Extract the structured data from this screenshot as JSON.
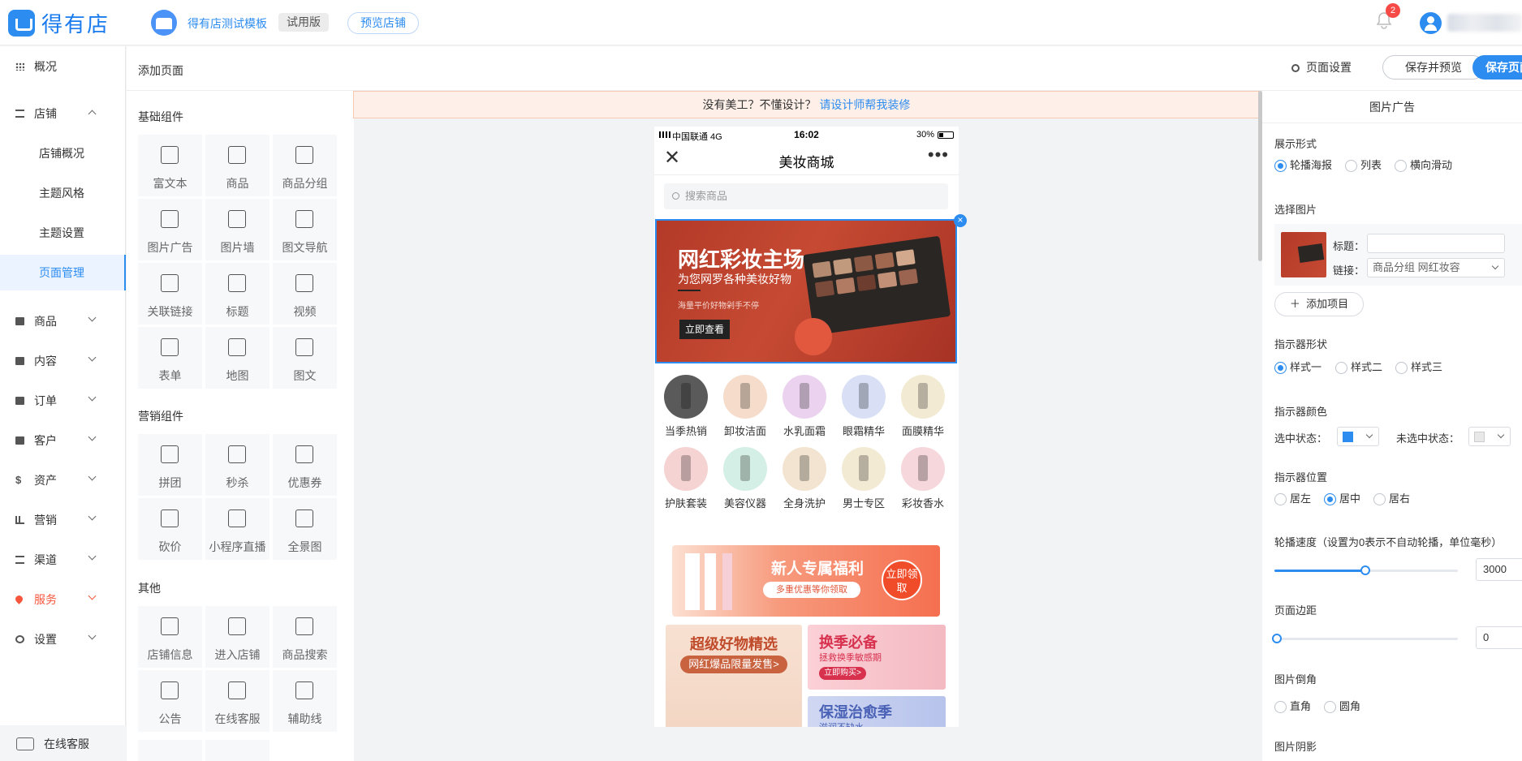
{
  "header": {
    "brand": "得有店",
    "store_name": "得有店测试模板",
    "plan": "试用版",
    "preview_store": "预览店铺",
    "notification_count": "2"
  },
  "nav": {
    "items": [
      {
        "label": "概况",
        "icon": "grid-icon"
      },
      {
        "label": "店铺",
        "icon": "store-icon",
        "expanded": true
      },
      {
        "label": "商品",
        "icon": "goods-icon"
      },
      {
        "label": "内容",
        "icon": "content-icon"
      },
      {
        "label": "订单",
        "icon": "order-icon"
      },
      {
        "label": "客户",
        "icon": "customer-icon"
      },
      {
        "label": "资产",
        "icon": "dollar-icon"
      },
      {
        "label": "营销",
        "icon": "chart-icon"
      },
      {
        "label": "渠道",
        "icon": "layers-icon"
      },
      {
        "label": "服务",
        "icon": "heart-icon",
        "color": "#f5563c"
      },
      {
        "label": "设置",
        "icon": "gear-icon"
      }
    ],
    "sub_items": [
      "店铺概况",
      "主题风格",
      "主题设置",
      "页面管理"
    ],
    "online_service": "在线客服"
  },
  "components": {
    "add_page": "添加页面",
    "basic_title": "基础组件",
    "basic": [
      "富文本",
      "商品",
      "商品分组",
      "图片广告",
      "图片墙",
      "图文导航",
      "关联链接",
      "标题",
      "视频",
      "表单",
      "地图",
      "图文"
    ],
    "marketing_title": "营销组件",
    "marketing": [
      "拼团",
      "秒杀",
      "优惠券",
      "砍价",
      "小程序直播",
      "全景图"
    ],
    "other_title": "其他",
    "other": [
      "店铺信息",
      "进入店铺",
      "商品搜索",
      "公告",
      "在线客服",
      "辅助线"
    ]
  },
  "toolbar": {
    "page_settings": "页面设置",
    "save_preview": "保存并预览",
    "save": "保存页面"
  },
  "tip": {
    "text": "没有美工？不懂设计？",
    "link": "请设计师帮我装修"
  },
  "phone": {
    "carrier": "中国联通  4G",
    "time": "16:02",
    "battery": "30%",
    "title": "美妆商城",
    "search_placeholder": "搜索商品",
    "banner": {
      "title": "网红彩妆主场",
      "subtitle": "为您网罗各种美妆好物",
      "note": "海量平价好物剁手不停",
      "button": "立即查看"
    },
    "categories": [
      {
        "label": "当季热销",
        "color": "#5a5a5a"
      },
      {
        "label": "卸妆洁面",
        "color": "#f5dccb"
      },
      {
        "label": "水乳面霜",
        "color": "#ebd3ef"
      },
      {
        "label": "眼霜精华",
        "color": "#d9dff5"
      },
      {
        "label": "面膜精华",
        "color": "#f3ead4"
      },
      {
        "label": "护肤套装",
        "color": "#f6d3d3"
      },
      {
        "label": "美容仪器",
        "color": "#d4efe5"
      },
      {
        "label": "全身洗护",
        "color": "#f2e4d0"
      },
      {
        "label": "男士专区",
        "color": "#f3ead4"
      },
      {
        "label": "彩妆香水",
        "color": "#f6d7dc"
      }
    ],
    "promo": {
      "title": "新人专属福利",
      "subtitle": "多重优惠等你领取",
      "badge": "立即领取"
    },
    "card_a": {
      "title": "超级好物精选",
      "tag": "网红爆品限量发售>"
    },
    "card_b": {
      "title": "换季必备",
      "subtitle": "拯救换季敏感期",
      "tag": "立即购买>"
    },
    "card_c": {
      "title": "保湿治愈季",
      "subtitle": "滋润不缺水"
    }
  },
  "panel": {
    "title": "图片广告",
    "display_label": "展示形式",
    "display_options": [
      "轮播海报",
      "列表",
      "横向滑动"
    ],
    "choose_image": "选择图片",
    "title_label": "标题：",
    "link_label": "链接：",
    "link_value": "商品分组  网红妆容",
    "add_item": "添加项目",
    "indicator_shape": "指示器形状",
    "shape_options": [
      "样式一",
      "样式二",
      "样式三"
    ],
    "indicator_color": "指示器颜色",
    "selected_state": "选中状态：",
    "unselected_state": "未选中状态：",
    "selected_color": "#2d8cf0",
    "unselected_color": "#e8e8e8",
    "indicator_position": "指示器位置",
    "position_options": [
      "居左",
      "居中",
      "居右"
    ],
    "speed_label": "轮播速度（设置为0表示不自动轮播，单位毫秒）",
    "speed_value": "3000",
    "margin_label": "页面边距",
    "margin_value": "0",
    "corner_label": "图片倒角",
    "corner_options": [
      "直角",
      "圆角"
    ],
    "shadow_label": "图片阴影"
  }
}
